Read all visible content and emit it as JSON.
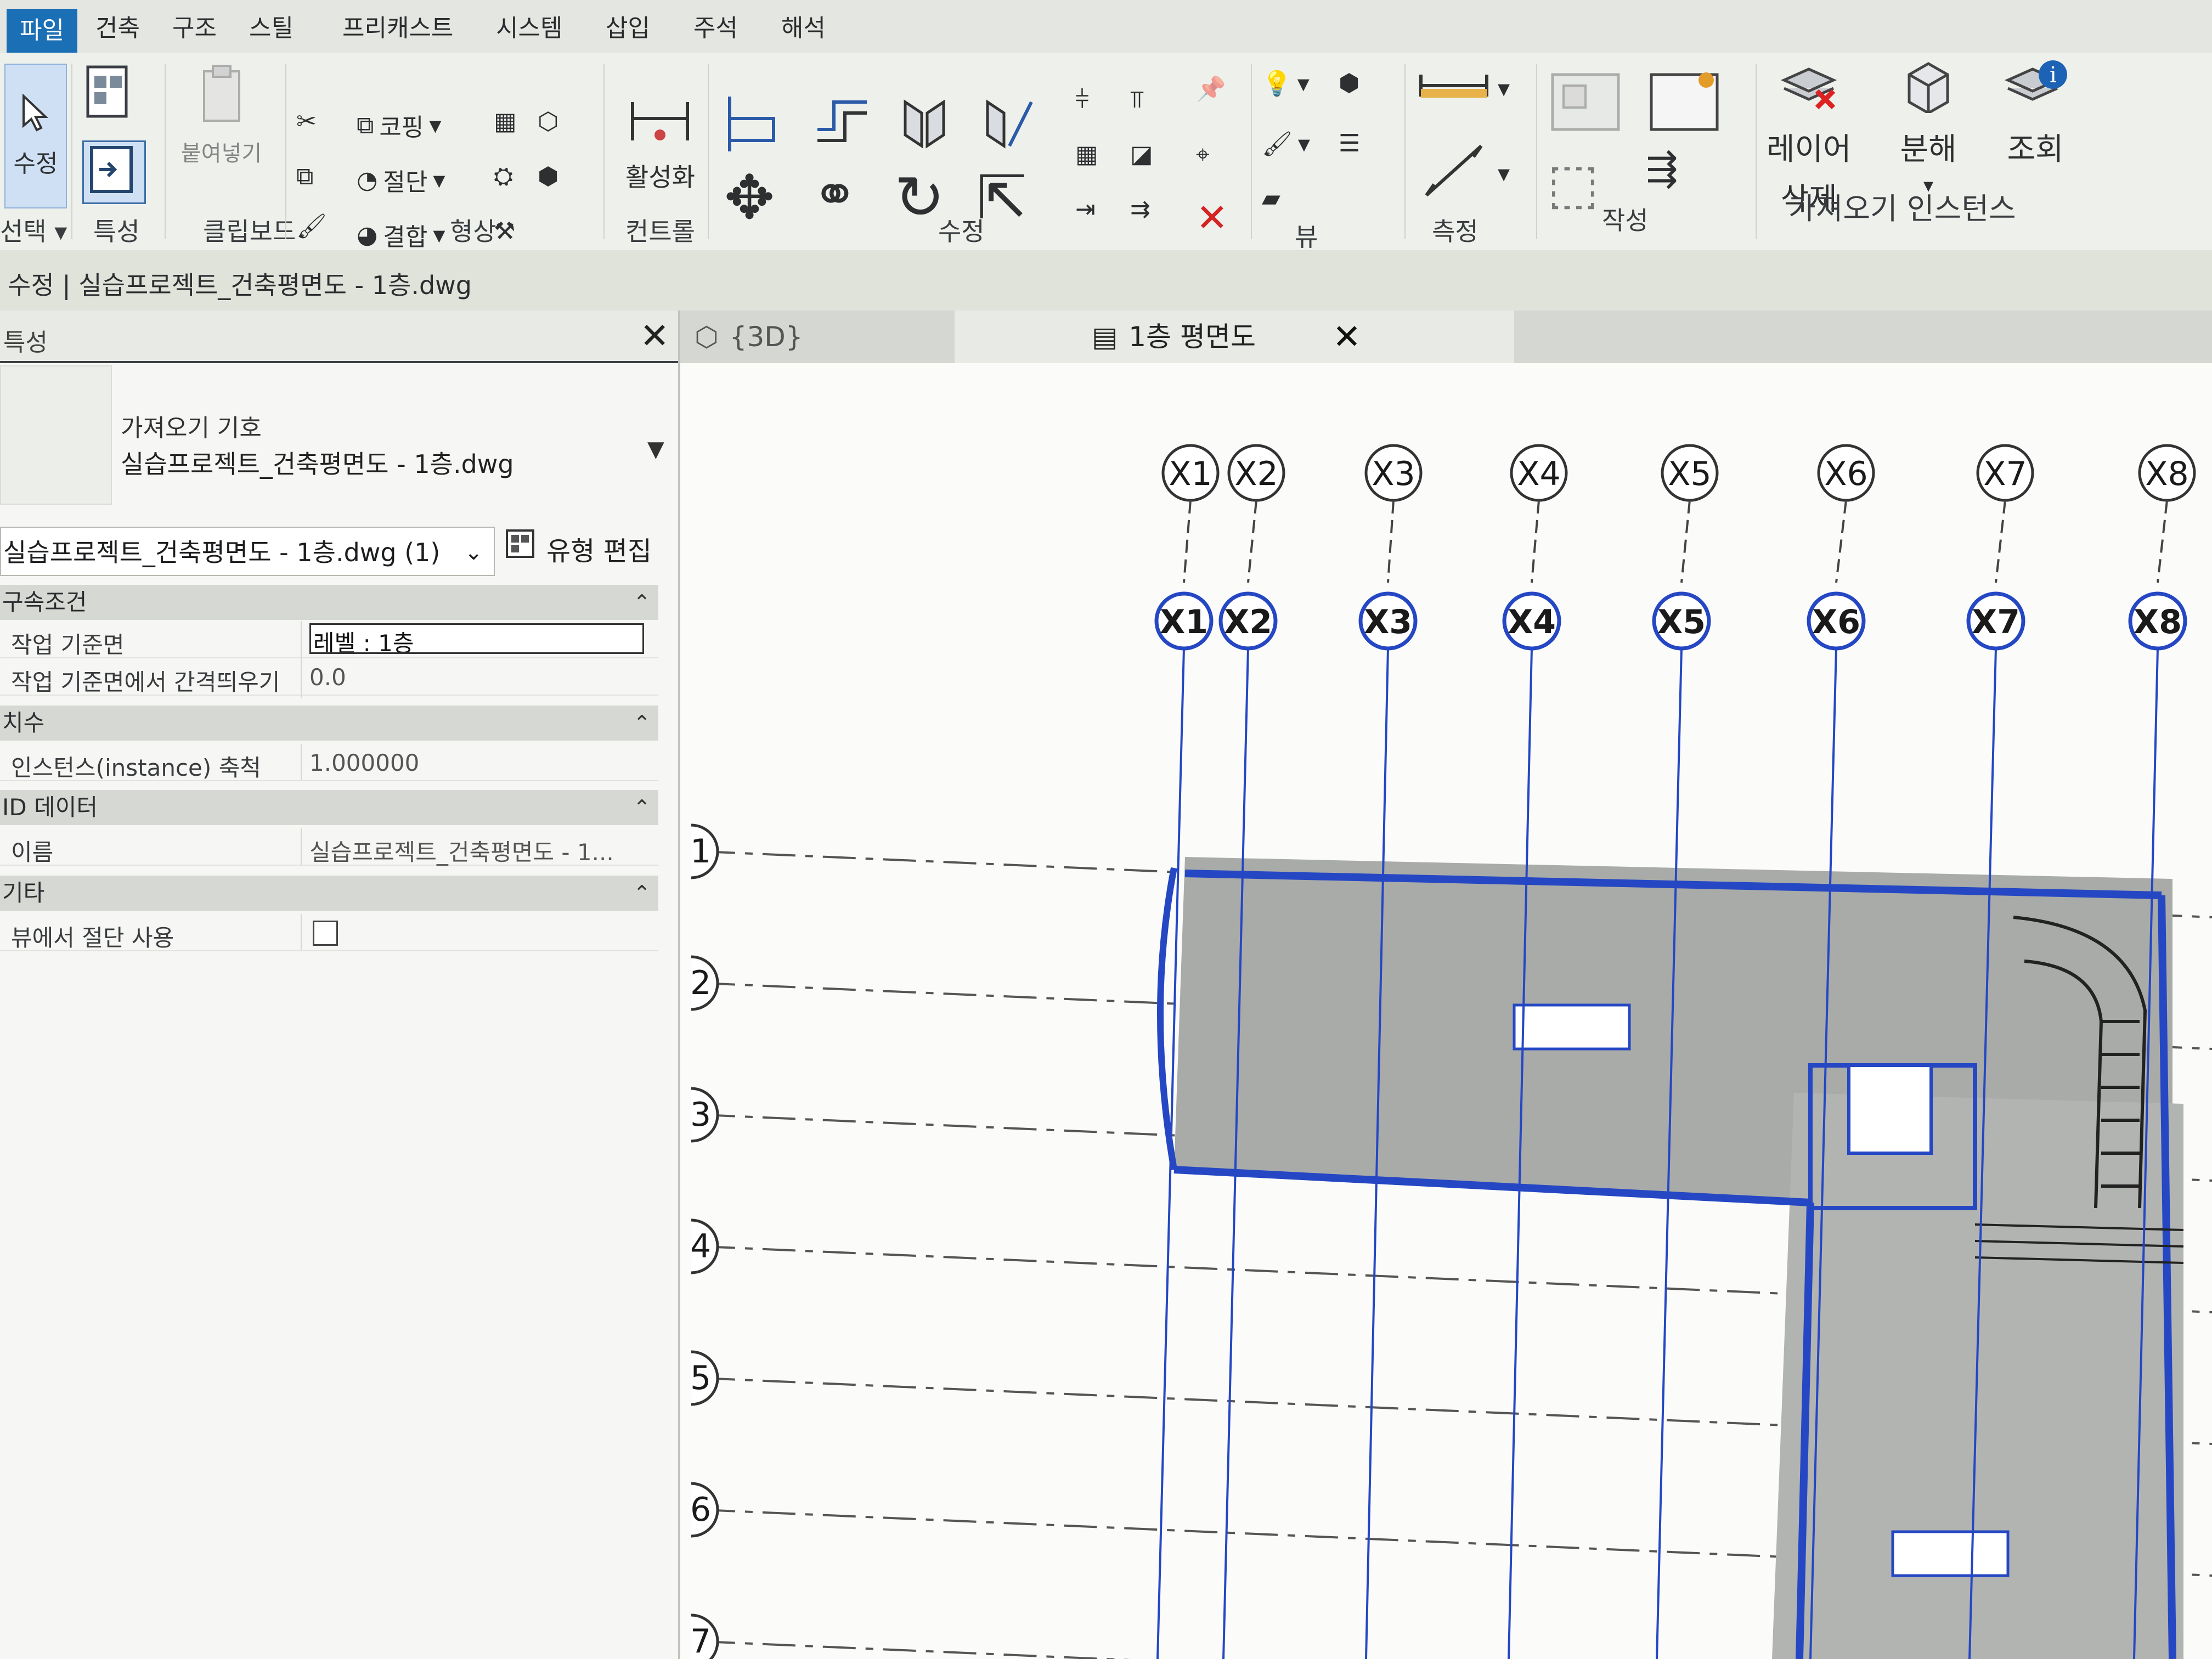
{
  "ribbon": {
    "tabs": [
      "파일",
      "건축",
      "구조",
      "스틸",
      "프리캐스트",
      "시스템",
      "삽입",
      "주석",
      "해석"
    ],
    "tools": {
      "modify": "수정",
      "paste": "붙여넣기",
      "cope": "코핑",
      "cut": "절단",
      "join": "결합",
      "activate": "활성화",
      "delete_layer_1": "레이어",
      "delete_layer_2": "삭제",
      "explode": "분해",
      "query": "조회"
    },
    "panels": {
      "select": "선택",
      "properties": "특성",
      "clipboard": "클립보드",
      "geometry": "형상",
      "controls": "컨트롤",
      "modify": "수정",
      "view": "뷰",
      "measure": "측정",
      "create": "작성",
      "import_instance": "가져오기 인스턴스"
    }
  },
  "status_bar": {
    "text": "수정 | 실습프로젝트_건축평면도 - 1층.dwg"
  },
  "properties": {
    "title": "특성",
    "type_category": "가져오기 기호",
    "type_name": "실습프로젝트_건축평면도 - 1층.dwg",
    "instance_selector": "실습프로젝트_건축평면도 - 1층.dwg (1)",
    "edit_type": "유형 편집",
    "groups": [
      {
        "name": "구속조건",
        "rows": [
          {
            "label": "작업 기준면",
            "value": "레벨 : 1층"
          },
          {
            "label": "작업 기준면에서 간격띄우기",
            "value": "0.0"
          }
        ]
      },
      {
        "name": "치수",
        "rows": [
          {
            "label": "인스턴스(instance) 축척",
            "value": "1.000000"
          }
        ]
      },
      {
        "name": "ID 데이터",
        "rows": [
          {
            "label": "이름",
            "value": "실습프로젝트_건축평면도 - 1..."
          }
        ]
      },
      {
        "name": "기타",
        "rows": [
          {
            "label": "뷰에서 절단 사용",
            "value": ""
          }
        ]
      }
    ]
  },
  "view_tabs": [
    {
      "label": "{3D}"
    },
    {
      "label": "1층 평면도"
    }
  ],
  "grid": {
    "upper_bubbles": [
      "X1",
      "X2",
      "X3",
      "X4",
      "X5",
      "X6",
      "X7",
      "X8"
    ],
    "lower_bubbles": [
      "X1",
      "X2",
      "X3",
      "X4",
      "X5",
      "X6",
      "X7",
      "X8"
    ],
    "row_bubbles": [
      "1",
      "2",
      "3",
      "4",
      "5",
      "6",
      "7"
    ]
  },
  "colors": {
    "ribbon_active_tab": "#1b6fb5",
    "grid_blue": "#2547c4",
    "wall_gray": "#a9aba8"
  }
}
